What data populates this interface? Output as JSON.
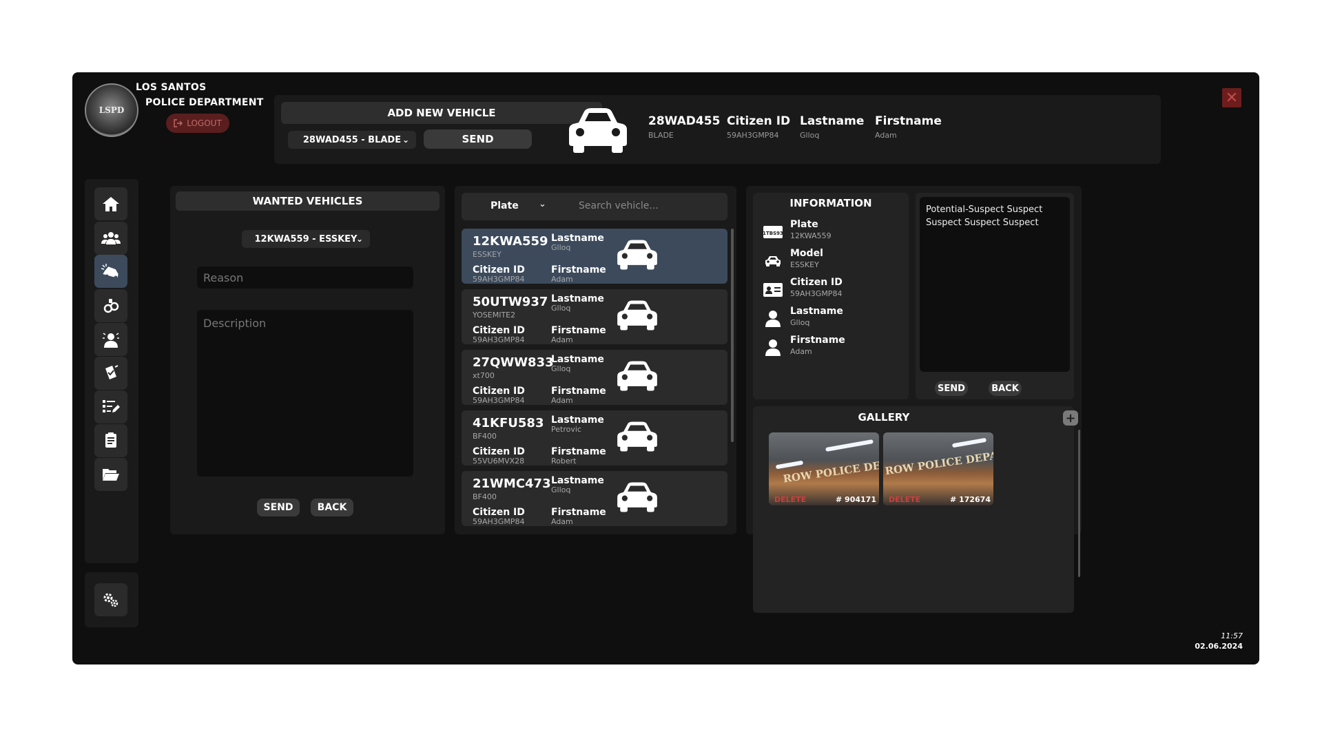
{
  "header": {
    "dept_line1": "LOS SANTOS",
    "dept_line2": "POLICE DEPARTMENT",
    "badge_text": "LSPD",
    "logout_label": "LOGOUT",
    "close_label": "✕"
  },
  "add_vehicle": {
    "title": "ADD NEW VEHICLE",
    "selected": "28WAD455 - BLADE",
    "send_label": "SEND"
  },
  "selected_vehicle": {
    "plate": "28WAD455",
    "model": "BLADE",
    "citizen_id_label": "Citizen ID",
    "citizen_id": "59AH3GMP84",
    "lastname_label": "Lastname",
    "lastname": "Glloq",
    "firstname_label": "Firstname",
    "firstname": "Adam"
  },
  "wanted": {
    "title": "WANTED VEHICLES",
    "selected": "12KWA559 - ESSKEY",
    "reason_placeholder": "Reason",
    "description_placeholder": "Description",
    "send_label": "SEND",
    "back_label": "BACK"
  },
  "search": {
    "filter": "Plate",
    "placeholder": "Search vehicle..."
  },
  "vehicles": [
    {
      "plate": "12KWA559",
      "model": "ESSKEY",
      "lastname_label": "Lastname",
      "lastname": "Glloq",
      "citizen_label": "Citizen ID",
      "citizen_id": "59AH3GMP84",
      "firstname_label": "Firstname",
      "firstname": "Adam"
    },
    {
      "plate": "50UTW937",
      "model": "YOSEMITE2",
      "lastname_label": "Lastname",
      "lastname": "Glloq",
      "citizen_label": "Citizen ID",
      "citizen_id": "59AH3GMP84",
      "firstname_label": "Firstname",
      "firstname": "Adam"
    },
    {
      "plate": "27QWW833",
      "model": "xt700",
      "lastname_label": "Lastname",
      "lastname": "Glloq",
      "citizen_label": "Citizen ID",
      "citizen_id": "59AH3GMP84",
      "firstname_label": "Firstname",
      "firstname": "Adam"
    },
    {
      "plate": "41KFU583",
      "model": "BF400",
      "lastname_label": "Lastname",
      "lastname": "Petrovic",
      "citizen_label": "Citizen ID",
      "citizen_id": "55VU6MVX28",
      "firstname_label": "Firstname",
      "firstname": "Robert"
    },
    {
      "plate": "21WMC473",
      "model": "BF400",
      "lastname_label": "Lastname",
      "lastname": "Glloq",
      "citizen_label": "Citizen ID",
      "citizen_id": "59AH3GMP84",
      "firstname_label": "Firstname",
      "firstname": "Adam"
    }
  ],
  "information": {
    "title": "INFORMATION",
    "rows": [
      {
        "label": "Plate",
        "value": "12KWA559",
        "icon": "license-plate-icon"
      },
      {
        "label": "Model",
        "value": "ESSKEY",
        "icon": "car-icon"
      },
      {
        "label": "Citizen ID",
        "value": "59AH3GMP84",
        "icon": "id-card-icon"
      },
      {
        "label": "Lastname",
        "value": "Glloq",
        "icon": "person-icon"
      },
      {
        "label": "Firstname",
        "value": "Adam",
        "icon": "person-icon"
      }
    ],
    "plate_icon_text": "81TBS937"
  },
  "notes": {
    "text": "Potential-Suspect Suspect Suspect Suspect Suspect",
    "send_label": "SEND",
    "back_label": "BACK"
  },
  "gallery": {
    "title": "GALLERY",
    "add_label": "+",
    "images": [
      {
        "id": "# 904171",
        "delete_label": "DELETE",
        "sign": "ROW POLICE DEP"
      },
      {
        "id": "# 172674",
        "delete_label": "DELETE",
        "sign": "ROW POLICE DEPA"
      }
    ]
  },
  "clock": {
    "time": "11:57",
    "date": "02.06.2024"
  },
  "colors": {
    "background": "#0f0f0f",
    "panel": "#1a1a1a",
    "selected_card": "#3c4a5c",
    "close": "#6e1d1d"
  }
}
